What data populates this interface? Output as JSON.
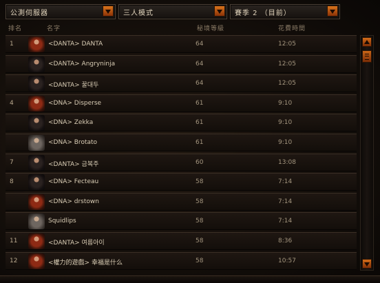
{
  "filters": {
    "server": "公測伺服器",
    "mode": "三人模式",
    "season": "賽季 2 （目前）"
  },
  "columns": {
    "rank": "排名",
    "name": "名字",
    "level": "秘境等級",
    "time": "花費時間"
  },
  "rows": [
    {
      "rank": "1",
      "name": "<DANTA> DANTA",
      "level": "64",
      "time": "12:05",
      "avatar": "female-hero-red-icon"
    },
    {
      "rank": "",
      "name": "<DANTA> Angryninja",
      "level": "64",
      "time": "12:05",
      "avatar": "female-hero-dark-icon"
    },
    {
      "rank": "",
      "name": "<DANTA> 꿀대두",
      "level": "64",
      "time": "12:05",
      "avatar": "female-hero-dark-icon"
    },
    {
      "rank": "4",
      "name": "<DNA> Disperse",
      "level": "61",
      "time": "9:10",
      "avatar": "female-hero-red-icon"
    },
    {
      "rank": "",
      "name": "<DNA> Zekka",
      "level": "61",
      "time": "9:10",
      "avatar": "female-hero-dark-icon"
    },
    {
      "rank": "",
      "name": "<DNA> Brotato",
      "level": "61",
      "time": "9:10",
      "avatar": "male-hero-grey-icon"
    },
    {
      "rank": "7",
      "name": "<DANTA> 금복주",
      "level": "60",
      "time": "13:08",
      "avatar": "female-hero-dark-icon"
    },
    {
      "rank": "8",
      "name": "<DNA> Fecteau",
      "level": "58",
      "time": "7:14",
      "avatar": "female-hero-dark-icon"
    },
    {
      "rank": "",
      "name": "<DNA> drstown",
      "level": "58",
      "time": "7:14",
      "avatar": "female-hero-red-icon"
    },
    {
      "rank": "",
      "name": "Squidlips",
      "level": "58",
      "time": "7:14",
      "avatar": "male-hero-grey-icon"
    },
    {
      "rank": "11",
      "name": "<DANTA> 여름아이",
      "level": "58",
      "time": "8:36",
      "avatar": "female-hero-red-icon"
    },
    {
      "rank": "12",
      "name": "<權力的遊戲> 幸福是什么",
      "level": "58",
      "time": "10:57",
      "avatar": "female-hero-red-icon"
    }
  ],
  "colors": {
    "accent": "#c8651a",
    "text": "#d9cdb5"
  },
  "icons": {
    "dropdown": "chevron-down-icon",
    "scroll_up": "arrow-up-icon",
    "scroll_down": "arrow-down-icon"
  }
}
